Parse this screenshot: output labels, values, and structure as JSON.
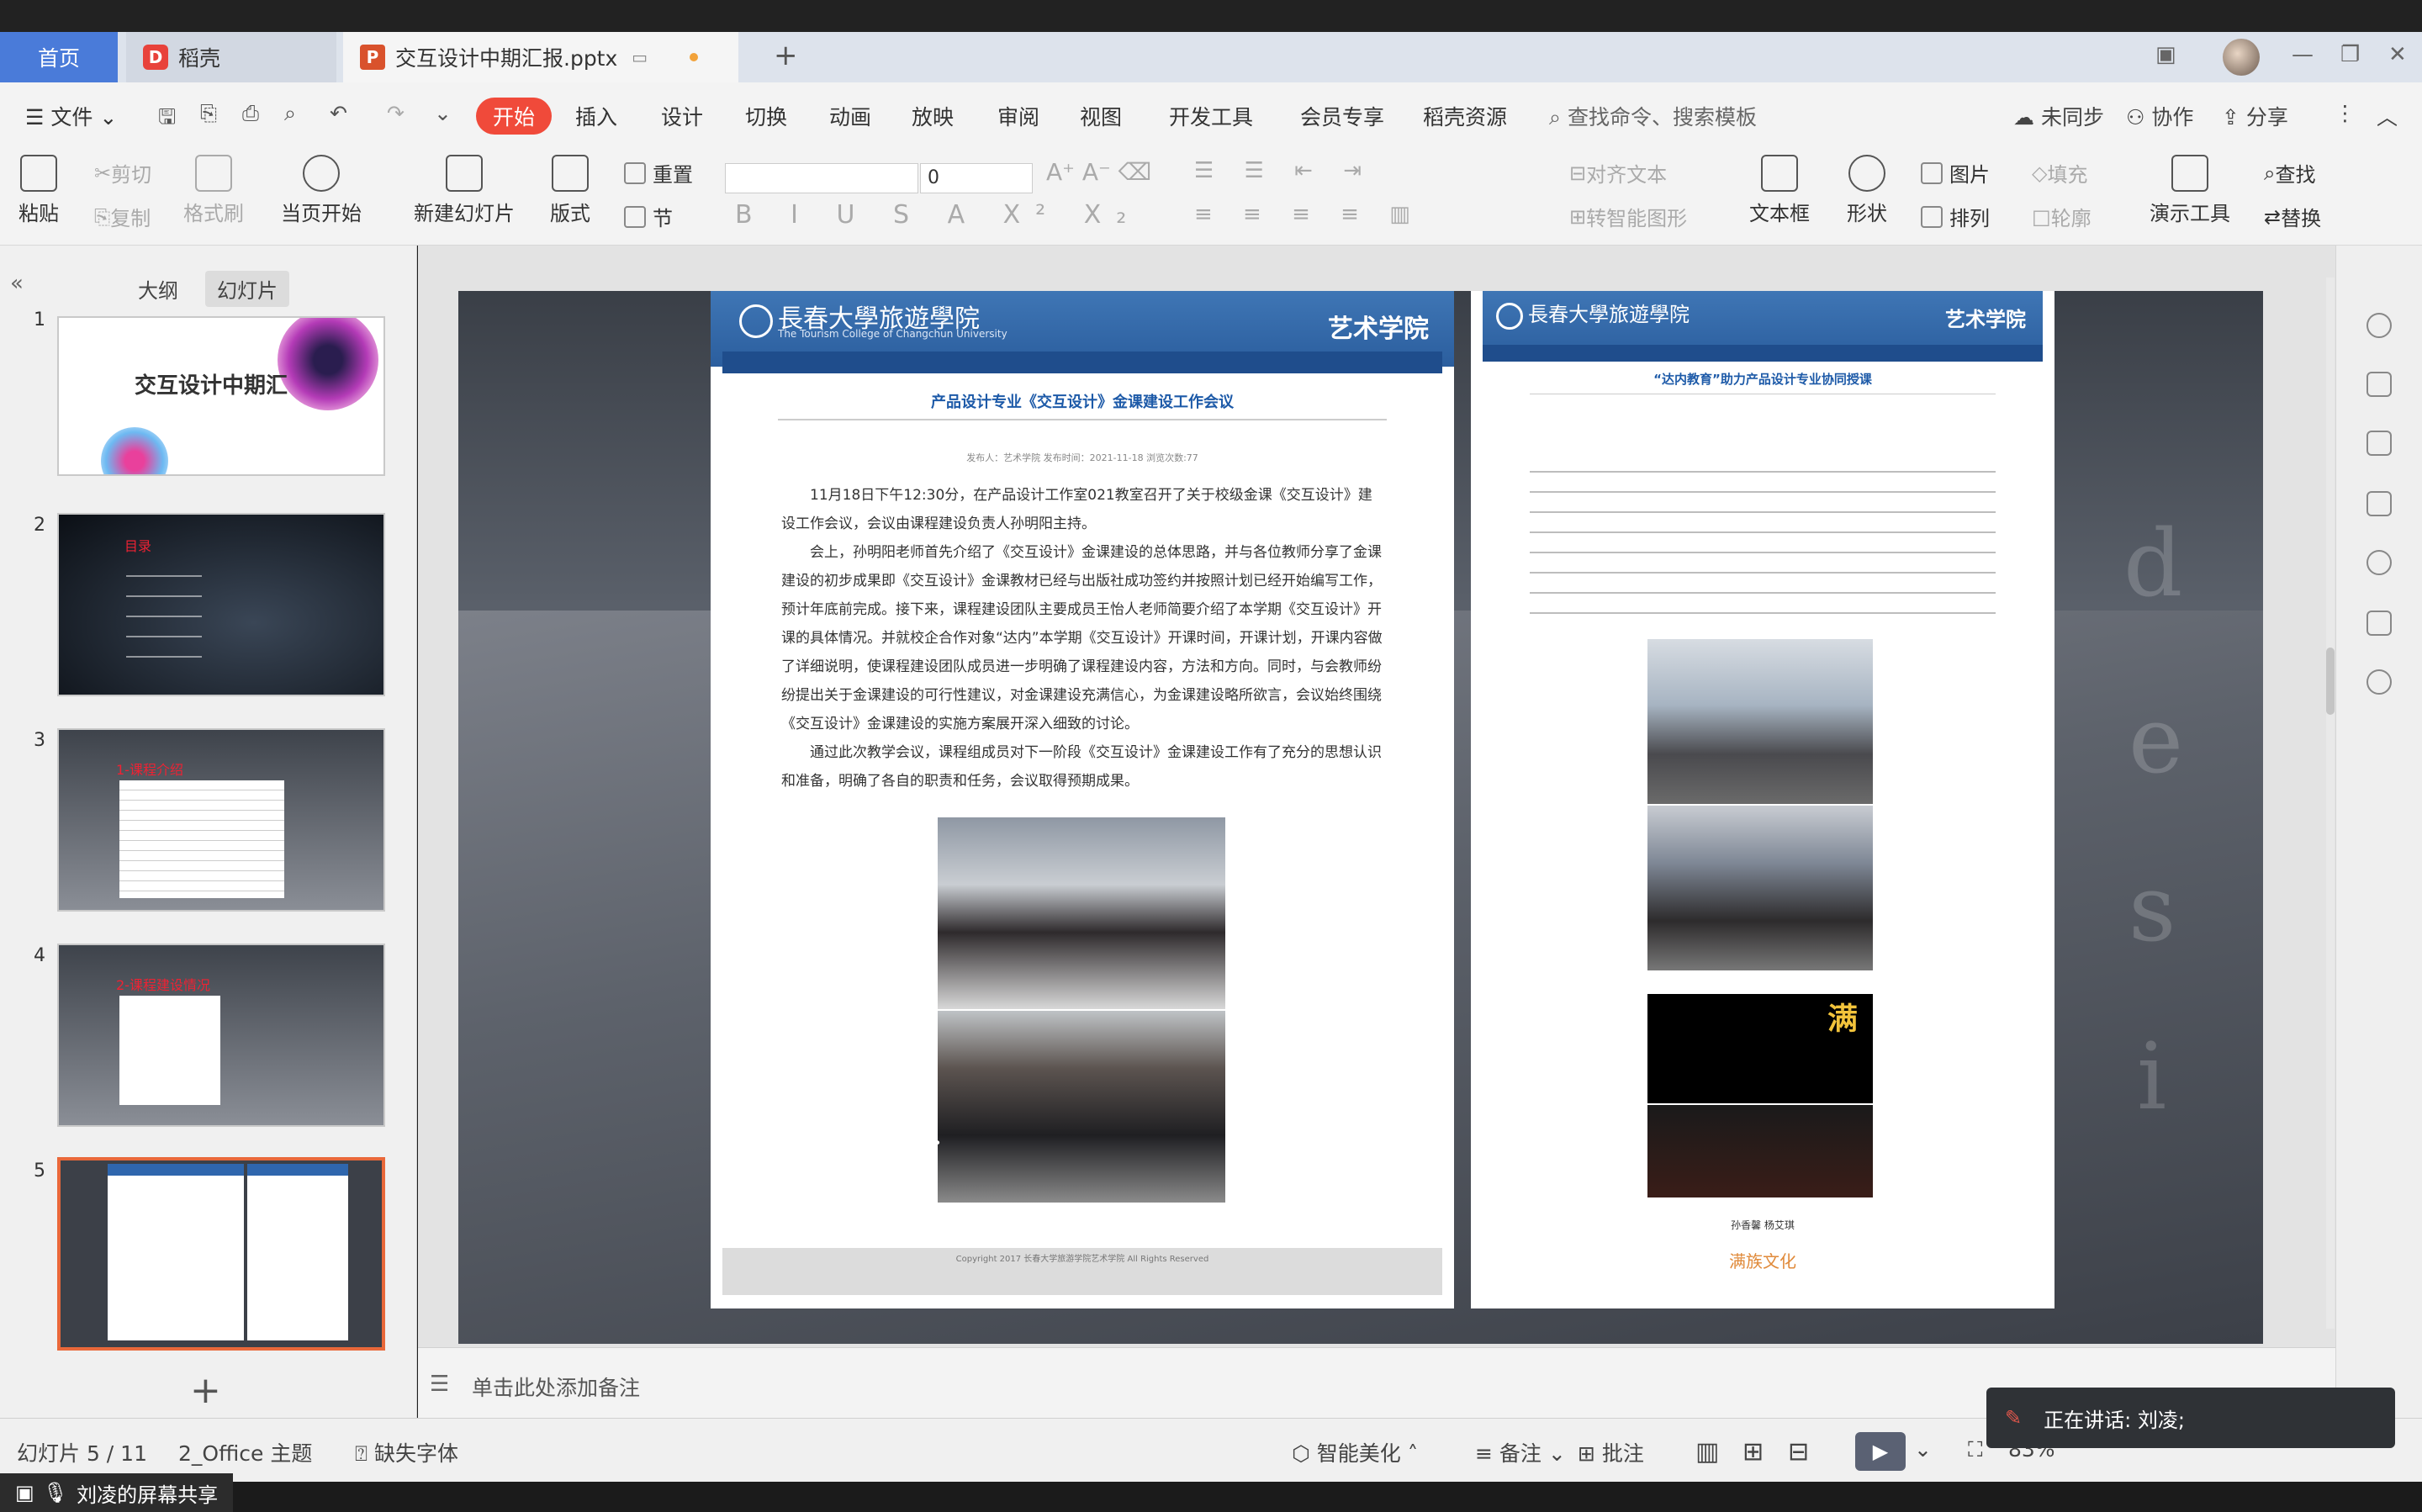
{
  "tabs": {
    "home": "首页",
    "docer": "稻壳",
    "file": "交互设计中期汇报.pptx"
  },
  "menu": {
    "file": "文件",
    "items": [
      "开始",
      "插入",
      "设计",
      "切换",
      "动画",
      "放映",
      "审阅",
      "视图",
      "开发工具",
      "会员专享",
      "稻壳资源"
    ],
    "search": "查找命令、搜索模板",
    "sync": "未同步",
    "collab": "协作",
    "share": "分享"
  },
  "ribbon": {
    "paste": "粘贴",
    "cut": "剪切",
    "copy": "复制",
    "format_painter": "格式刷",
    "from_current": "当页开始",
    "new_slide": "新建幻灯片",
    "layout": "版式",
    "reset": "重置",
    "section": "节",
    "font_size": "0",
    "align_text": "对齐文本",
    "smart_art": "转智能图形",
    "textbox": "文本框",
    "shape": "形状",
    "picture": "图片",
    "arrange": "排列",
    "fill": "填充",
    "outline": "轮廓",
    "presenter": "演示工具",
    "find": "查找",
    "replace": "替换"
  },
  "leftpanel": {
    "outline_tab": "大纲",
    "slides_tab": "幻灯片",
    "slides": [
      {
        "num": "1",
        "title": "交互设计中期汇"
      },
      {
        "num": "2",
        "title": "目录"
      },
      {
        "num": "3",
        "title": "1-课程介绍"
      },
      {
        "num": "4",
        "title": "2-课程建设情况"
      },
      {
        "num": "5",
        "title": ""
      }
    ]
  },
  "slide": {
    "left_page": {
      "university": "長春大學旅遊學院",
      "university_en": "The Tourism College of Changchun University",
      "college": "艺术学院",
      "article_title": "产品设计专业《交互设计》金课建设工作会议",
      "meta": "发布人：艺术学院  发布时间：2021-11-18  浏览次数:77",
      "body": [
        "11月18日下午12:30分，在产品设计工作室021教室召开了关于校级金课《交互设计》建设工作会议，会议由课程建设负责人孙明阳主持。",
        "会上，孙明阳老师首先介绍了《交互设计》金课建设的总体思路，并与各位教师分享了金课建设的初步成果即《交互设计》金课教材已经与出版社成功签约并按照计划已经开始编写工作，预计年底前完成。接下来，课程建设团队主要成员王怡人老师简要介绍了本学期《交互设计》开课的具体情况。并就校企合作对象“达内”本学期《交互设计》开课时间，开课计划，开课内容做了详细说明，使课程建设团队成员进一步明确了课程建设内容，方法和方向。同时，与会教师纷纷提出关于金课建设的可行性建议，对金课建设充满信心，为金课建设略所欲言，会议始终围绕《交互设计》金课建设的实施方案展开深入细致的讨论。",
        "通过此次教学会议，课程组成员对下一阶段《交互设计》金课建设工作有了充分的思想认识和准备，明确了各自的职责和任务，会议取得预期成果。"
      ],
      "footer": "Copyright 2017 长春大学旅游学院艺术学院 All Rights Reserved"
    },
    "right_page": {
      "university": "長春大學旅遊學院",
      "college": "艺术学院",
      "article_title": "“达内教育”助力产品设计专业协同授课",
      "caption": "孙香馨 杨艾琪",
      "poster_text": "满族文化"
    },
    "design_letters": [
      "d",
      "e",
      "s",
      "i"
    ]
  },
  "notes": {
    "placeholder": "单击此处添加备注"
  },
  "status": {
    "slide_count": "幻灯片 5 / 11",
    "theme": "2_Office 主题",
    "missing_font": "缺失字体",
    "beautify": "智能美化",
    "notes": "备注",
    "comments": "批注",
    "zoom": "83%"
  },
  "overlay": {
    "share_label": "刘凌的屏幕共享",
    "speaking": "正在讲话: 刘凌;"
  }
}
